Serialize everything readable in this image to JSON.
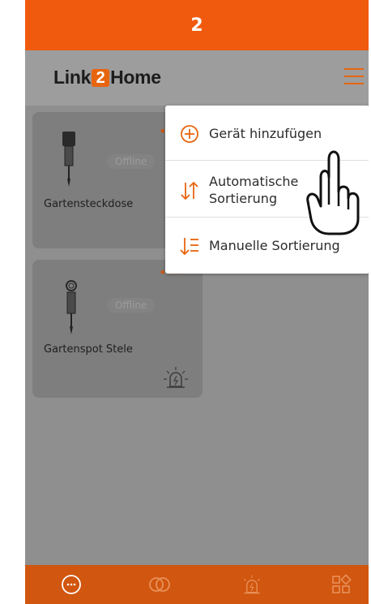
{
  "step": {
    "number": "2"
  },
  "header": {
    "logo": {
      "part1": "Link",
      "digit": "2",
      "part2": "Home"
    },
    "menu_icon": "hamburger-icon"
  },
  "devices": [
    {
      "name": "Gartensteckdose",
      "status": "Offline",
      "icon": "plug-icon"
    },
    {
      "name": "Gartenspot Stele",
      "status": "Offline",
      "icon": "spotlight-icon",
      "alarm_icon": "alarm-light-icon"
    }
  ],
  "menu": {
    "items": [
      {
        "label": "Gerät hinzufügen",
        "icon": "plus-circle-icon"
      },
      {
        "label_line1": "Automatische",
        "label_line2": "Sortierung",
        "icon": "sort-arrows-icon"
      },
      {
        "label": "Manuelle Sortierung",
        "icon": "sort-list-icon"
      }
    ]
  },
  "bottom_nav": [
    {
      "icon": "devices-icon"
    },
    {
      "icon": "links-icon"
    },
    {
      "icon": "alarm-icon"
    },
    {
      "icon": "scenes-icon"
    }
  ],
  "colors": {
    "accent": "#f05a0e",
    "nav": "#d1560f",
    "overlay": "#8f8f8f"
  }
}
